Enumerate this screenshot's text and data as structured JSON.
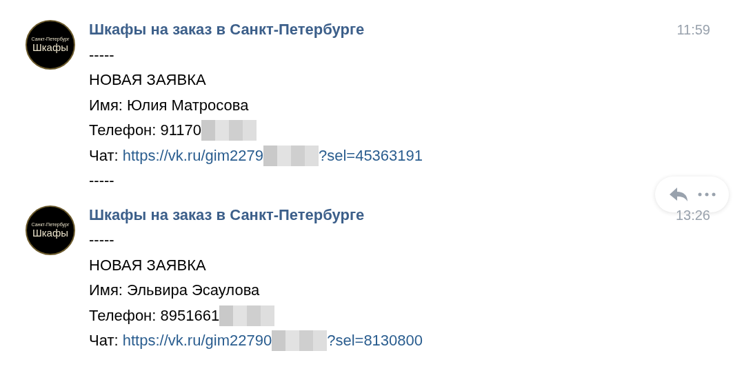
{
  "messages": [
    {
      "avatar": {
        "lines": [
          "Санкт-Петербург",
          "Шкафы"
        ]
      },
      "author": "Шкафы на заказ в Санкт-Петербурге",
      "time": "11:59",
      "hovered": true,
      "lines": [
        [
          {
            "kind": "text",
            "text": "-----"
          }
        ],
        [
          {
            "kind": "text",
            "text": "НОВАЯ ЗАЯВКА"
          }
        ],
        [
          {
            "kind": "text",
            "text": "Имя: Юлия Матросова"
          }
        ],
        [
          {
            "kind": "text",
            "text": "Телефон: 91170"
          },
          {
            "kind": "redacted"
          }
        ],
        [
          {
            "kind": "text",
            "text": "Чат: "
          },
          {
            "kind": "link",
            "text": "https://vk.ru/gim2279"
          },
          {
            "kind": "redacted"
          },
          {
            "kind": "link",
            "text": "?sel=45363191"
          }
        ],
        [
          {
            "kind": "text",
            "text": "-----"
          }
        ]
      ]
    },
    {
      "avatar": {
        "lines": [
          "Санкт-Петербург",
          "Шкафы"
        ]
      },
      "author": "Шкафы на заказ в Санкт-Петербурге",
      "time": "13:26",
      "hovered": false,
      "lines": [
        [
          {
            "kind": "text",
            "text": "-----"
          }
        ],
        [
          {
            "kind": "text",
            "text": "НОВАЯ ЗАЯВКА"
          }
        ],
        [
          {
            "kind": "text",
            "text": "Имя: Эльвира Эсаулова"
          }
        ],
        [
          {
            "kind": "text",
            "text": "Телефон: 8951661"
          },
          {
            "kind": "redacted"
          }
        ],
        [
          {
            "kind": "text",
            "text": "Чат: "
          },
          {
            "kind": "link",
            "text": "https://vk.ru/gim22790"
          },
          {
            "kind": "redacted"
          },
          {
            "kind": "link",
            "text": "?sel=8130800"
          }
        ]
      ]
    }
  ]
}
